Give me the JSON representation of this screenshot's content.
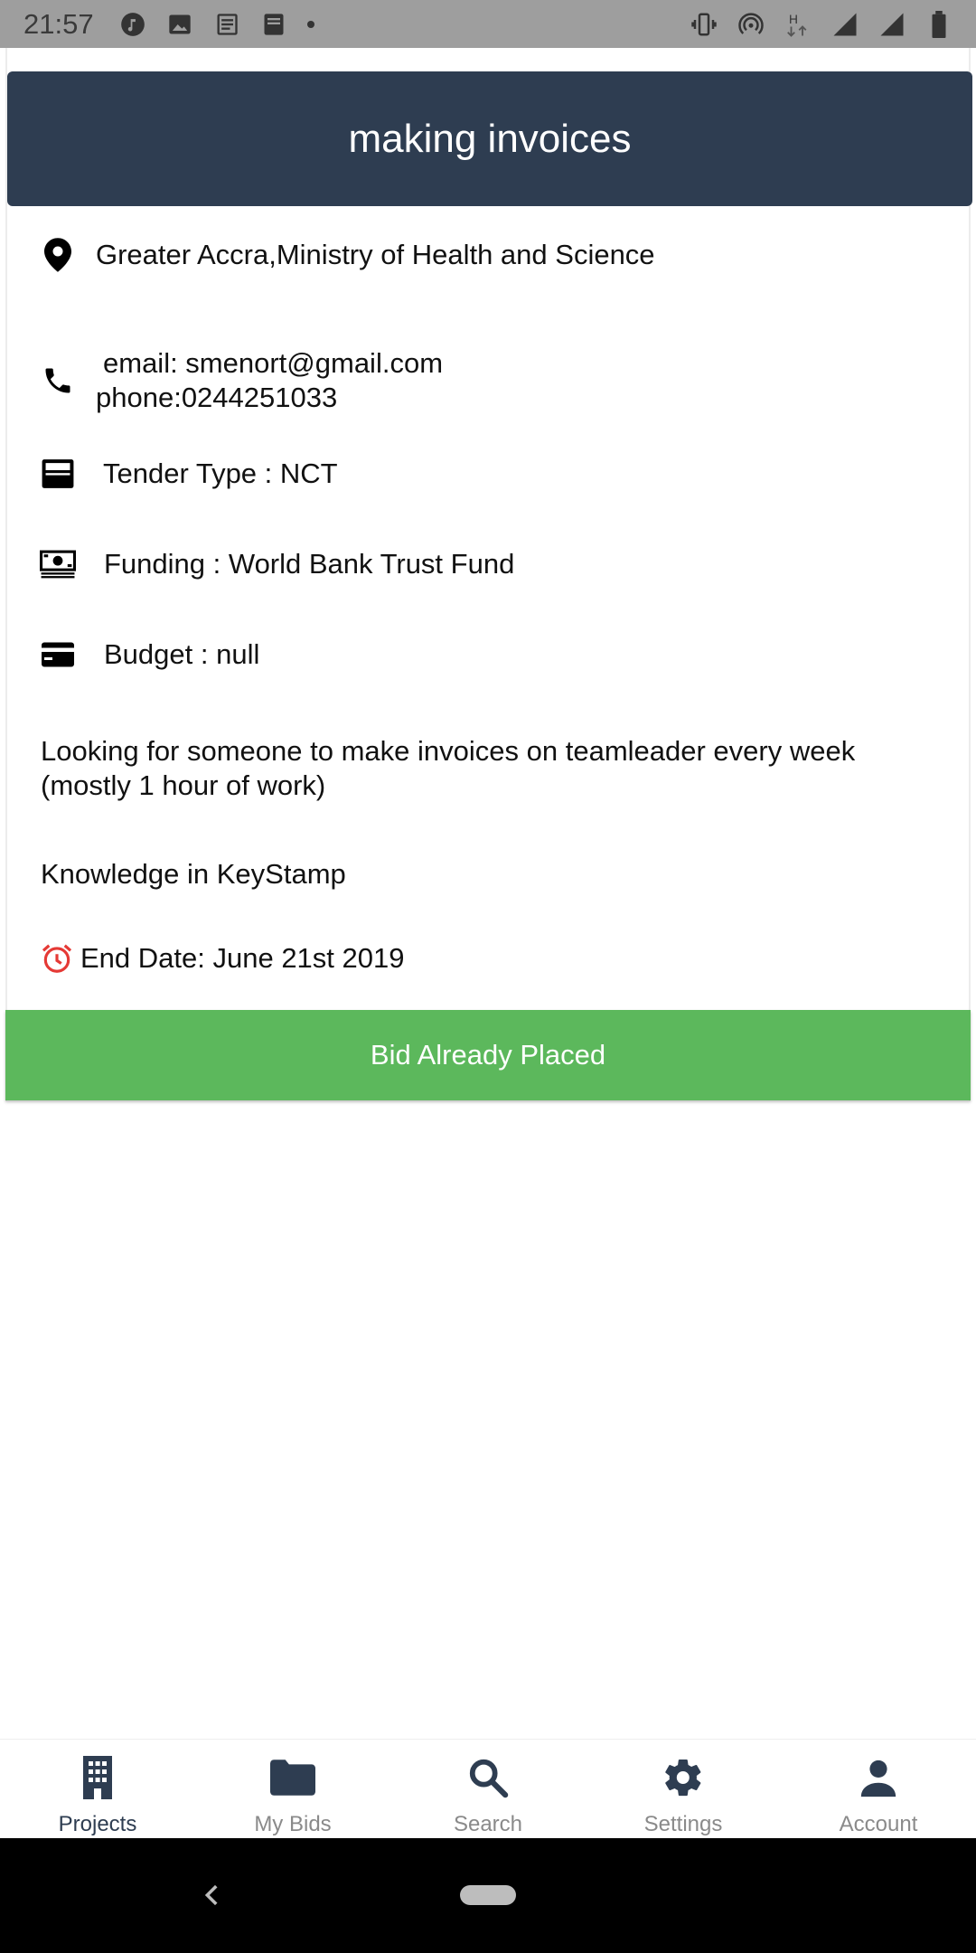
{
  "status_bar": {
    "time": "21:57"
  },
  "card": {
    "title": "making invoices",
    "location": "Greater Accra,Ministry of Health and Science",
    "email": "email: smenort@gmail.com",
    "phone": "phone:0244251033",
    "tender_type": "Tender Type : NCT",
    "funding": "Funding : World Bank Trust Fund",
    "budget": "Budget : null",
    "description": "Looking for someone to make invoices on teamleader every week (mostly 1 hour of work)",
    "knowledge": "Knowledge in KeyStamp",
    "end_date": "End Date:  June 21st 2019",
    "bid_button_label": "Bid Already Placed"
  },
  "bottom_nav": {
    "items": [
      {
        "label": "Projects",
        "icon": "building-icon",
        "active": true
      },
      {
        "label": "My Bids",
        "icon": "folder-icon",
        "active": false
      },
      {
        "label": "Search",
        "icon": "search-icon",
        "active": false
      },
      {
        "label": "Settings",
        "icon": "gear-icon",
        "active": false
      },
      {
        "label": "Account",
        "icon": "person-icon",
        "active": false
      }
    ]
  },
  "colors": {
    "header_bg": "#2e3d51",
    "bid_button_bg": "#5cb85c",
    "alarm_icon": "#e53935",
    "nav_active": "#2e3d51",
    "nav_inactive": "#8a8a8a"
  }
}
